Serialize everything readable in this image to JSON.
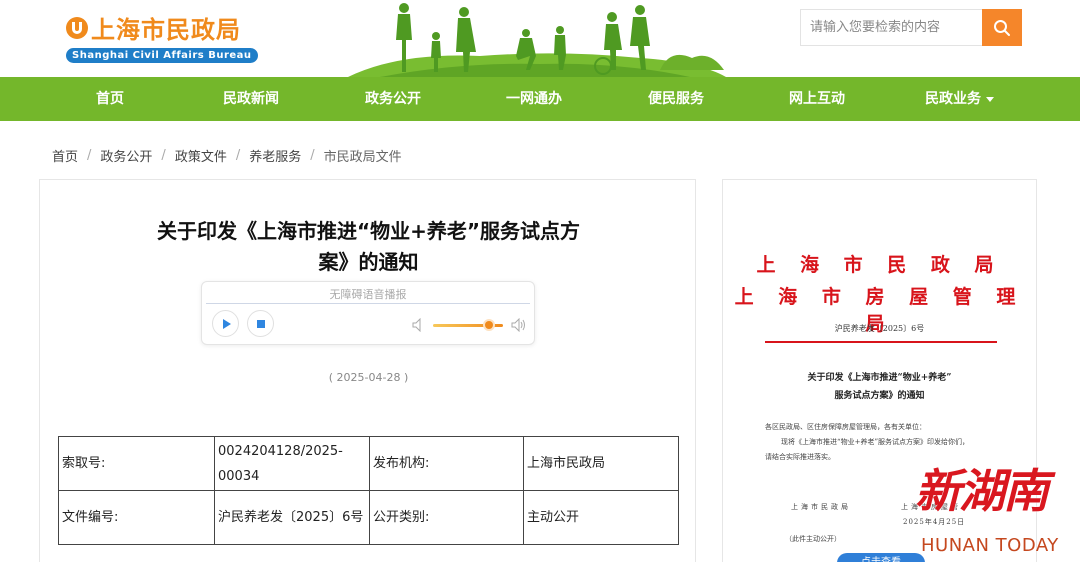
{
  "header": {
    "logo_cn": "上海市民政局",
    "logo_en": "Shanghai Civil Affairs Bureau",
    "search": {
      "placeholder": "请输入您要检索的内容"
    },
    "colors": {
      "brand_orange": "#f08a1c",
      "brand_blue": "#1f7ec8",
      "search_orange": "#f5862a"
    }
  },
  "nav": {
    "color": "#74b72b",
    "items": [
      {
        "label": "首页"
      },
      {
        "label": "民政新闻"
      },
      {
        "label": "政务公开"
      },
      {
        "label": "一网通办"
      },
      {
        "label": "便民服务"
      },
      {
        "label": "网上互动"
      },
      {
        "label": "民政业务",
        "has_dropdown": true
      }
    ]
  },
  "breadcrumb": [
    "首页",
    "政务公开",
    "政策文件",
    "养老服务",
    "市民政局文件"
  ],
  "article": {
    "title_line1": "关于印发《上海市推进“物业+养老”服务试点方",
    "title_line2": "案》的通知",
    "player": {
      "label": "无障碍语音播报",
      "volume_level": 0.8,
      "icons": [
        "play-icon",
        "stop-icon",
        "volume-low-icon",
        "volume-high-icon"
      ]
    },
    "date": "( 2025-04-28 )",
    "meta_table": [
      {
        "label1": "索取号:",
        "value1": "0024204128/2025-00034",
        "label2": "发布机构:",
        "value2": "上海市民政局"
      },
      {
        "label1": "文件编号:",
        "value1": "沪民养老发〔2025〕6号",
        "label2": "公开类别:",
        "value2": "主动公开"
      }
    ]
  },
  "document": {
    "issuer_line1": "上 海 市 民 政 局",
    "issuer_line2": "上 海 市 房 屋 管 理 局",
    "doc_number": "沪民养老发〔2025〕6号",
    "title_line1": "关于印发《上海市推进“物业+养老”",
    "title_line2": "服务试点方案》的通知",
    "body_line1": "各区民政局、区住房保障房屋管理局，各有关单位：",
    "body_line2": "现将《上海市推进“物业+养老”服务试点方案》印发给你们，",
    "body_line3": "请结合实际推进落实。",
    "sign_left": "上海市民政局",
    "sign_right": "上海市房屋管",
    "sign_date": "2025年4月25日",
    "disclosure": "（此件主动公开）",
    "view_button": "点击查看",
    "accent_red": "#d8141b"
  },
  "watermark": {
    "cn": "新湖南",
    "en": "HUNAN TODAY"
  }
}
